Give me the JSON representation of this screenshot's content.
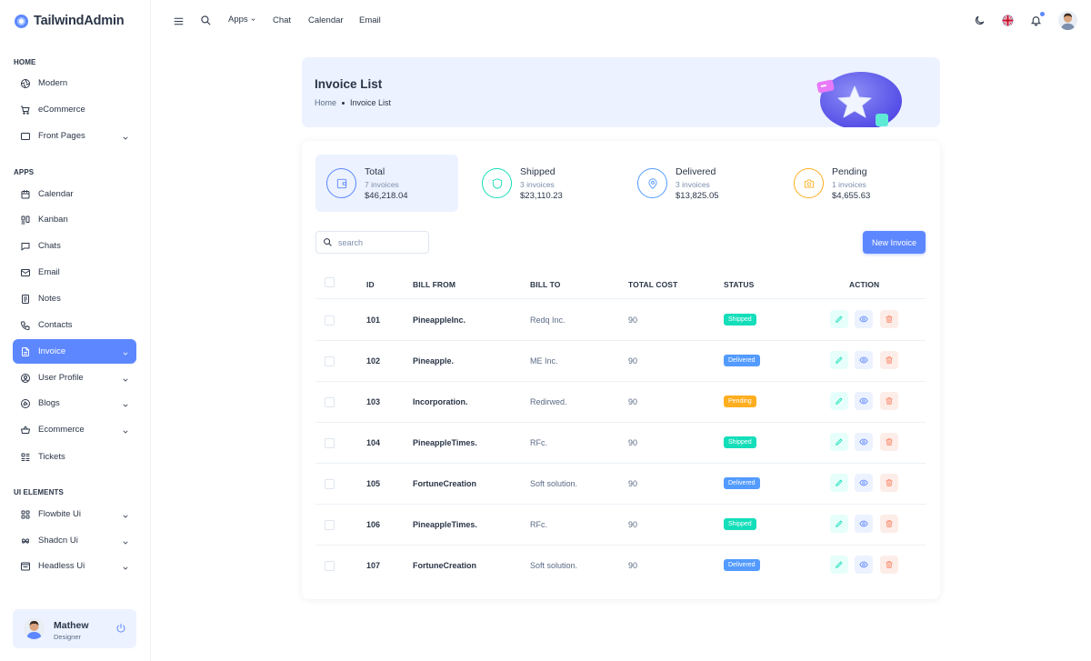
{
  "app": {
    "name": "TailwindAdmin"
  },
  "topbar": {
    "apps": "Apps",
    "chat": "Chat",
    "calendar": "Calendar",
    "email": "Email"
  },
  "sidebar": {
    "sections": [
      {
        "caption": "HOME",
        "items": [
          {
            "label": "Modern",
            "icon": "aperture-icon"
          },
          {
            "label": "eCommerce",
            "icon": "cart-icon"
          },
          {
            "label": "Front Pages",
            "icon": "layout-icon",
            "has_children": true
          }
        ]
      },
      {
        "caption": "APPS",
        "items": [
          {
            "label": "Calendar",
            "icon": "calendar-icon"
          },
          {
            "label": "Kanban",
            "icon": "kanban-icon"
          },
          {
            "label": "Chats",
            "icon": "chat-icon"
          },
          {
            "label": "Email",
            "icon": "mail-icon"
          },
          {
            "label": "Notes",
            "icon": "notes-icon"
          },
          {
            "label": "Contacts",
            "icon": "phone-icon"
          },
          {
            "label": "Invoice",
            "icon": "file-icon",
            "has_children": true,
            "active": true
          },
          {
            "label": "User Profile",
            "icon": "user-circle-icon",
            "has_children": true
          },
          {
            "label": "Blogs",
            "icon": "blog-icon",
            "has_children": true
          },
          {
            "label": "Ecommerce",
            "icon": "basket-icon",
            "has_children": true
          },
          {
            "label": "Tickets",
            "icon": "tickets-icon"
          }
        ]
      },
      {
        "caption": "UI ELEMENTS",
        "items": [
          {
            "label": "Flowbite Ui",
            "icon": "grid-icon",
            "has_children": true
          },
          {
            "label": "Shadcn Ui",
            "icon": "shadcn-icon",
            "has_children": true
          },
          {
            "label": "Headless Ui",
            "icon": "browser-icon",
            "has_children": true
          }
        ]
      }
    ]
  },
  "profile": {
    "name": "Mathew",
    "role": "Designer"
  },
  "page": {
    "title": "Invoice List",
    "breadcrumb": {
      "home": "Home",
      "current": "Invoice List"
    }
  },
  "stats": [
    {
      "title": "Total",
      "count": "7 invoices",
      "amount": "$46,218.04",
      "color": "#5d87ff",
      "icon": "wallet-icon"
    },
    {
      "title": "Shipped",
      "count": "3 invoices",
      "amount": "$23,110.23",
      "color": "#13deb9",
      "icon": "shield-icon"
    },
    {
      "title": "Delivered",
      "count": "3 invoices",
      "amount": "$13,825.05",
      "color": "#539bff",
      "icon": "location-icon"
    },
    {
      "title": "Pending",
      "count": "1 invoices",
      "amount": "$4,655.63",
      "color": "#ffae1f",
      "icon": "camera-icon"
    }
  ],
  "search": {
    "placeholder": "search",
    "value": ""
  },
  "new_invoice_label": "New Invoice",
  "table": {
    "headers": [
      "ID",
      "BILL FROM",
      "BILL TO",
      "TOTAL COST",
      "STATUS",
      "ACTION"
    ],
    "rows": [
      {
        "id": "101",
        "bill_from": "PineappleInc.",
        "bill_to": "Redq Inc.",
        "total": "90",
        "status": "Shipped"
      },
      {
        "id": "102",
        "bill_from": "Pineapple.",
        "bill_to": "ME Inc.",
        "total": "90",
        "status": "Delivered"
      },
      {
        "id": "103",
        "bill_from": "Incorporation.",
        "bill_to": "Redirwed.",
        "total": "90",
        "status": "Pending"
      },
      {
        "id": "104",
        "bill_from": "PineappleTimes.",
        "bill_to": "RFc.",
        "total": "90",
        "status": "Shipped"
      },
      {
        "id": "105",
        "bill_from": "FortuneCreation",
        "bill_to": "Soft solution.",
        "total": "90",
        "status": "Delivered"
      },
      {
        "id": "106",
        "bill_from": "PineappleTimes.",
        "bill_to": "RFc.",
        "total": "90",
        "status": "Shipped"
      },
      {
        "id": "107",
        "bill_from": "FortuneCreation",
        "bill_to": "Soft solution.",
        "total": "90",
        "status": "Delivered"
      }
    ]
  },
  "status_colors": {
    "Shipped": "#13deb9",
    "Delivered": "#539bff",
    "Pending": "#ffae1f"
  },
  "colors": {
    "primary": "#5d87ff",
    "primary_light": "#ecf2ff",
    "edit_bg": "#e6fffa",
    "edit": "#13deb9",
    "view_bg": "#ecf2ff",
    "view": "#5d87ff",
    "delete_bg": "#fdede8",
    "delete": "#fa896b"
  }
}
